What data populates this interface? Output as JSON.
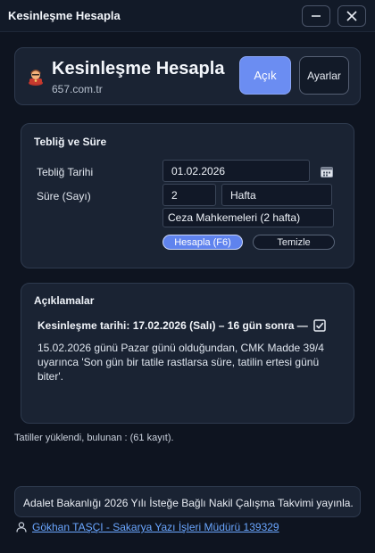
{
  "window": {
    "title": "Kesinleşme Hesapla",
    "minimize_icon": "minimize-icon",
    "close_icon": "close-icon"
  },
  "header": {
    "logo_icon": "judge-avatar-icon",
    "title": "Kesinleşme Hesapla",
    "url": "657.com.tr",
    "open_label": "Açık",
    "settings_label": "Ayarlar"
  },
  "form": {
    "section_title": "Tebliğ ve Süre",
    "notification_label": "Tebliğ Tarihi",
    "notification_date": "01.02.2026",
    "calendar_icon": "calendar-icon",
    "duration_label": "Süre (Sayı)",
    "duration_value": "2",
    "duration_unit": "Hafta",
    "court_type": "Ceza Mahkemeleri (2 hafta)",
    "calculate_label": "Hesapla (F6)",
    "clear_label": "Temizle"
  },
  "explanation": {
    "section_title": "Açıklamalar",
    "result": "Kesinleşme tarihi: 17.02.2026 (Salı) – 16 gün sonra —",
    "check_icon": "checkbox-checked-icon",
    "description": "15.02.2026 günü Pazar  günü olduğundan, CMK Madde 39/4 uyarınca 'Son gün bir tatile rastlarsa süre, tatilin ertesi günü biter'."
  },
  "status": "Tatiller yüklendi, bulunan : (61 kayıt).",
  "news": "Adalet Bakanlığı 2026 Yılı İsteğe Bağlı Nakil Çalışma Takvimi yayınla...",
  "footer": {
    "user_icon": "user-icon",
    "author_link": "Gökhan TAŞÇI - Sakarya Yazı İşleri Müdürü 139329"
  }
}
